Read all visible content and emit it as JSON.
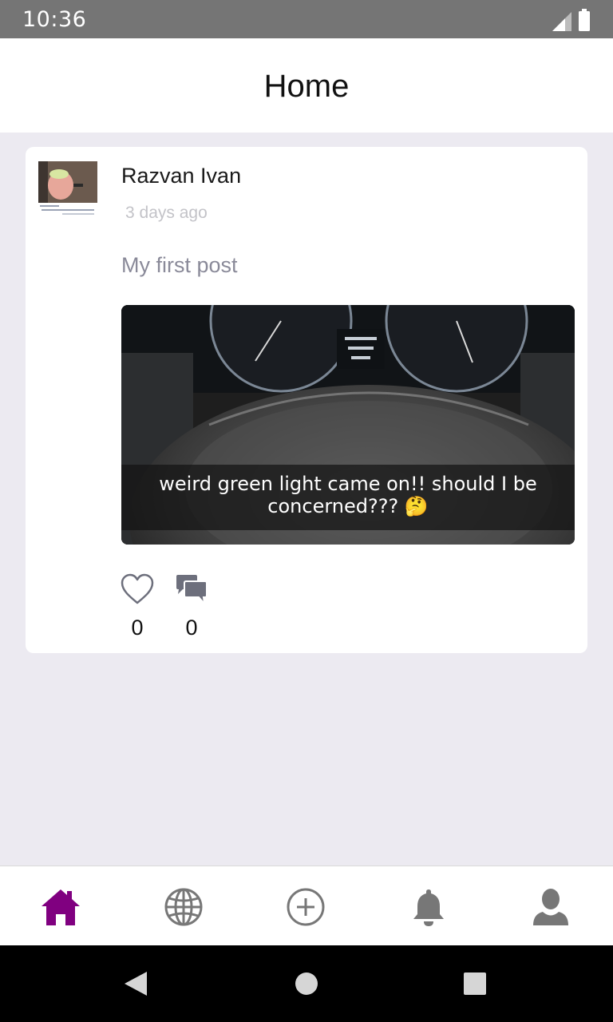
{
  "status_bar": {
    "time": "10:36",
    "icons": [
      "signal-icon",
      "battery-icon"
    ]
  },
  "header": {
    "title": "Home"
  },
  "post": {
    "author": "Razvan Ivan",
    "time_ago": "3 days ago",
    "text": "My first post",
    "image_caption": "weird green light came on!! should I be concerned??? 🤔",
    "likes": "0",
    "comments": "0"
  },
  "bottom_nav": {
    "active": "home",
    "items": [
      "home-icon",
      "globe-icon",
      "add-circle-icon",
      "bell-icon",
      "profile-icon"
    ],
    "active_color": "#800080",
    "inactive_color": "#777777"
  },
  "system_nav": {
    "buttons": [
      "back-icon",
      "home-circle-icon",
      "recents-icon"
    ]
  }
}
